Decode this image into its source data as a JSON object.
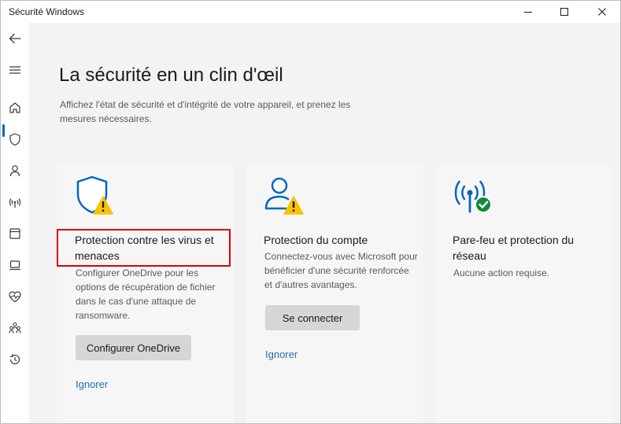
{
  "window": {
    "title": "Sécurité Windows"
  },
  "main": {
    "title": "La sécurité en un clin d'œil",
    "subtitle": "Affichez l'état de sécurité et d'intégrité de votre appareil, et prenez les mesures nécessaires."
  },
  "cards": [
    {
      "title": "Protection contre les virus et menaces",
      "description": "Configurer OneDrive pour les options de récupération de fichier dans le cas d'une attaque de ransomware.",
      "button_label": "Configurer OneDrive",
      "link_label": "Ignorer",
      "icon": "shield-warning-icon"
    },
    {
      "title": "Protection du compte",
      "description": "Connectez-vous avec Microsoft pour bénéficier d'une sécurité renforcée et d'autres avantages.",
      "button_label": "Se connecter",
      "link_label": "Ignorer",
      "icon": "person-warning-icon"
    },
    {
      "title": "Pare-feu et protection du réseau",
      "description": "Aucune action requise.",
      "icon": "wifi-ok-icon"
    }
  ],
  "colors": {
    "accent": "#0067c0",
    "warning": "#f8c300",
    "ok": "#0f8a3c",
    "highlight": "#e00000",
    "link": "#1f6fb2"
  }
}
